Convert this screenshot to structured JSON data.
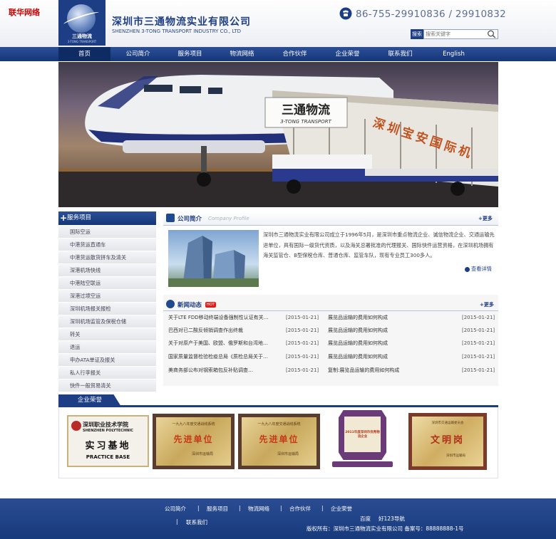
{
  "corner_logo": "联华网络",
  "header": {
    "company_cn": "深圳市三通物流实业有限公司",
    "company_en": "SHENZHEN 3-TONG TRANSPORT INDUSTRY CO., LTD",
    "logo_text": "三通物流",
    "logo_sub": "3-TONG TRANSPORT",
    "phone": "86-755-29910836 / 29910832",
    "search_label": "搜索",
    "search_placeholder": "搜索关键字"
  },
  "nav": [
    "首页",
    "公司简介",
    "服务项目",
    "物流网络",
    "合作伙伴",
    "企业荣誉",
    "联系我们",
    "English"
  ],
  "banner": {
    "sign_cn": "三通物流",
    "sign_en": "3-TONG TRANSPORT",
    "stair_text": "深圳宝安国际机"
  },
  "sidebar": {
    "title": "服务项目",
    "items": [
      "国际空运",
      "中港货运直通车",
      "中港货运散货拼车及清关",
      "深港机场快线",
      "中港陆空联运",
      "深港过境空运",
      "深圳机场报关报检",
      "深圳机场监管及保税仓储",
      "转关",
      "退运",
      "申办ATA单证及报关",
      "私人行李报关",
      "快件一般贸易清关"
    ]
  },
  "profile": {
    "title": "公司简介",
    "subtitle": "Company Profile",
    "more": "+更多",
    "text": "深圳市三通物流实业有限公司成立于1996年5月，是深圳市重点物流企业、诚信物流企业、交通运输先进单位，具有国际一级货代资质，以及海关总署批准的代理报关、国际快件运营资格，在深圳机场拥有海关监管仓、B型保税仓库、普通仓库、监管车队，现有专业员工300多人。",
    "detail": "查看详情"
  },
  "news": {
    "title": "新闻动态",
    "badge": "HOT",
    "more": "+更多",
    "left": [
      {
        "title": "关于LTE FDD移动终端设备强制性认证有关…",
        "date": "[2015-01-21]"
      },
      {
        "title": "巴西对已二酸反倾销调查作出终裁",
        "date": "[2015-01-21]"
      },
      {
        "title": "关于对原产于美国、欧盟、俄罗斯和台湾地…",
        "date": "[2015-01-21]"
      },
      {
        "title": "国家质量监督检验检疫总局《质检总局关于…",
        "date": "[2015-01-21]"
      },
      {
        "title": "美商务部公布对钢索箱包反补贴调查…",
        "date": "[2015-01-21]"
      }
    ],
    "right": [
      {
        "title": "展览品运输的费用如何构成",
        "date": "[2015-01-21]"
      },
      {
        "title": "展览品运输的费用如何构成",
        "date": "[2015-01-21]"
      },
      {
        "title": "展览品运输的费用如何构成",
        "date": "[2015-01-21]"
      },
      {
        "title": "展览品运输的费用如何构成",
        "date": "[2015-01-21]"
      },
      {
        "title": "复制:展览品运输的费用如何构成",
        "date": "[2015-01-21]"
      }
    ]
  },
  "honors": {
    "title": "企业荣誉",
    "plaques": [
      {
        "top": "深圳职业技术学院",
        "en": "SHENZHEN POLYTECHNIC",
        "main": "实习基地",
        "bottom": "PRACTICE BASE"
      },
      {
        "top": "一九九八年度交通战线系统",
        "main": "先进单位",
        "bottom": "深圳市运输局"
      },
      {
        "top": "一九九八年度交通战线系统",
        "main": "先进单位",
        "bottom": "深圳市运输局"
      },
      {
        "top": "2011年度深圳市优秀物流企业",
        "main": "",
        "bottom": ""
      },
      {
        "top": "深圳市交通运输委员会",
        "main": "文明岗",
        "bottom": "深圳市运输局"
      }
    ]
  },
  "footer": {
    "links": [
      "公司简介",
      "服务项目",
      "物流网络",
      "合作伙伴",
      "企业荣誉",
      "联系我们"
    ],
    "friend_links": [
      "百度",
      "好123导航"
    ],
    "copyright": "版权所有：深圳市三通物流实业有限公司 备案号：88888888-1号"
  }
}
